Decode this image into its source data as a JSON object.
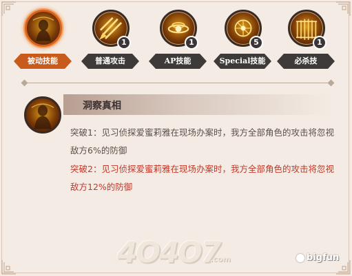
{
  "tabs": [
    {
      "label": "被动技能",
      "badge": null,
      "icon": "passive-skill-icon",
      "active": true
    },
    {
      "label": "普通攻击",
      "badge": "1",
      "icon": "normal-attack-icon",
      "active": false
    },
    {
      "label": "AP技能",
      "badge": "1",
      "icon": "ap-skill-icon",
      "active": false
    },
    {
      "label": "Special技能",
      "badge": "5",
      "icon": "special-skill-icon",
      "active": false
    },
    {
      "label": "必杀技",
      "badge": "1",
      "icon": "ultimate-skill-icon",
      "active": false
    }
  ],
  "skill": {
    "name": "洞察真相",
    "icon": "insight-skill-icon",
    "desc1": "突破1：见习侦探爱蜜莉雅在现场办案时，我方全部角色的攻击将忽视敌方6%的防御",
    "desc2": "突破2：见习侦探爱蜜莉雅在现场办案时，我方全部角色的攻击将忽视敌方12%的防御"
  },
  "watermark": {
    "site": "4O4O7",
    "site_suffix": ".com",
    "brand": "bigfun"
  },
  "colors": {
    "background": "#f4ece4",
    "active_tab": "#c85a1c",
    "tab_label": "#3f3a3a",
    "highlight_text": "#c0392b"
  }
}
